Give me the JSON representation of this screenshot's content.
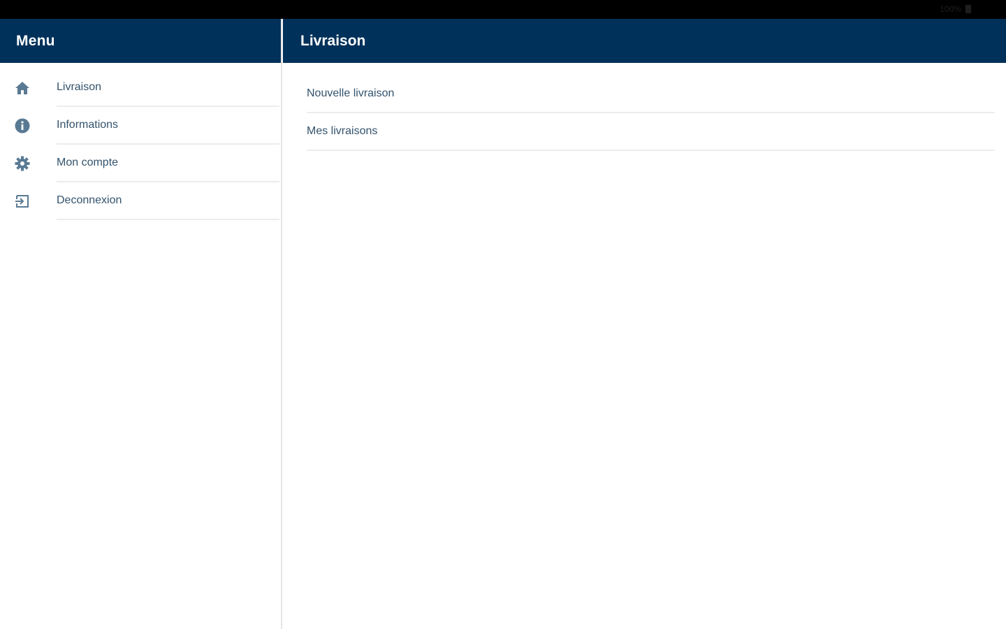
{
  "status_bar": {
    "battery_text": "100%",
    "battery_icon": "battery-icon"
  },
  "sidebar": {
    "title": "Menu",
    "items": [
      {
        "label": "Livraison",
        "icon": "home-icon"
      },
      {
        "label": "Informations",
        "icon": "info-icon"
      },
      {
        "label": "Mon compte",
        "icon": "gear-icon"
      },
      {
        "label": "Deconnexion",
        "icon": "logout-icon"
      }
    ]
  },
  "main": {
    "title": "Livraison",
    "items": [
      {
        "label": "Nouvelle livraison"
      },
      {
        "label": "Mes livraisons"
      }
    ]
  },
  "colors": {
    "header_bg": "#00315a",
    "text": "#33536d",
    "icon": "#5a7a93",
    "divider": "#ececec"
  }
}
